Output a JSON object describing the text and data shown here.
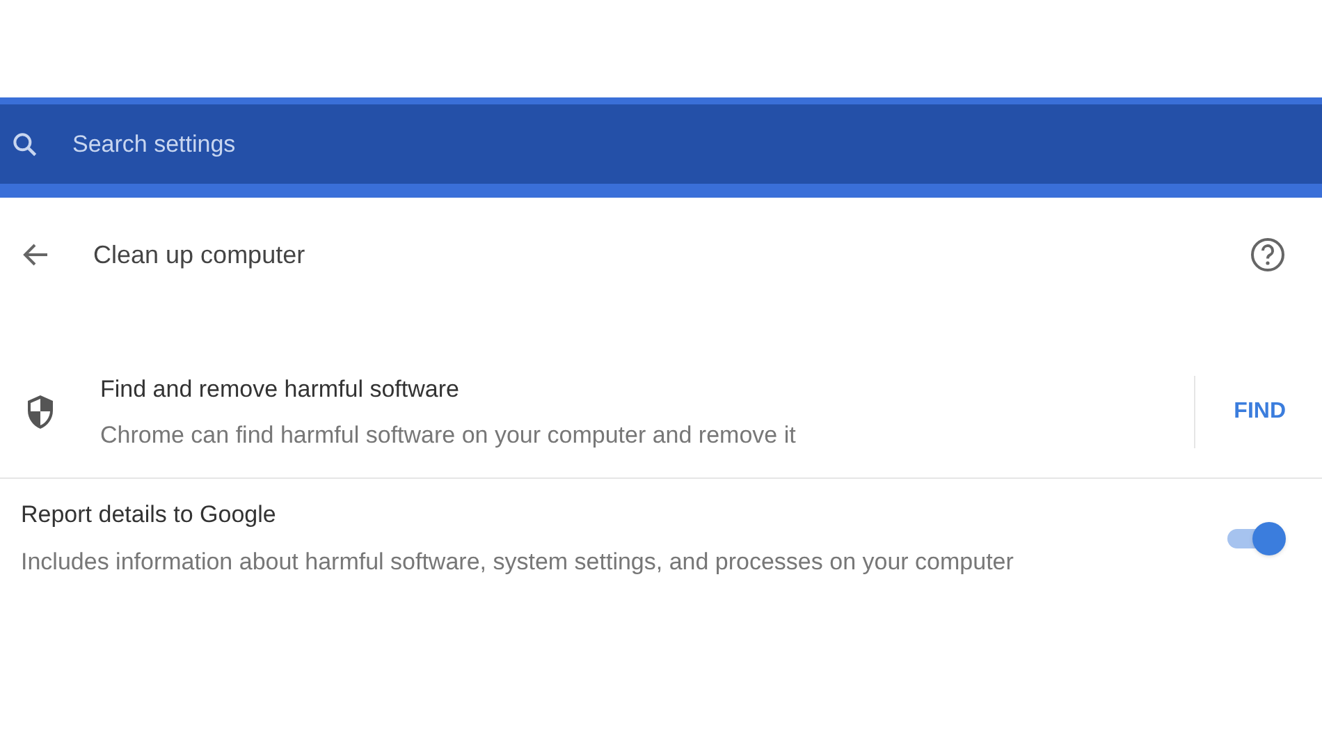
{
  "search": {
    "placeholder": "Search settings"
  },
  "page": {
    "title": "Clean up computer"
  },
  "find_row": {
    "title": "Find and remove harmful software",
    "description": "Chrome can find harmful software on your computer and remove it",
    "button": "FIND"
  },
  "report_row": {
    "title": "Report details to Google",
    "description": "Includes information about harmful software, system settings, and processes on your computer",
    "on": true
  }
}
